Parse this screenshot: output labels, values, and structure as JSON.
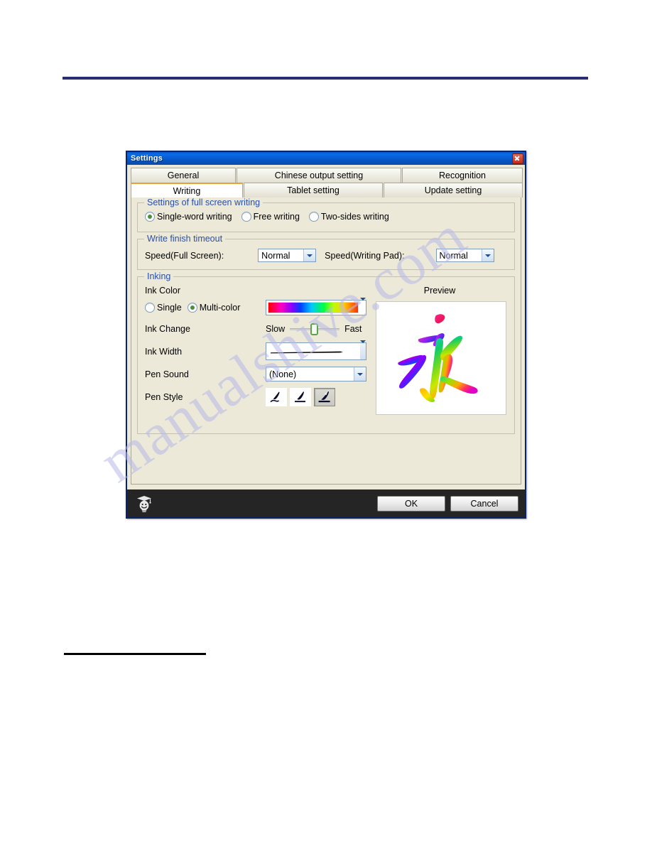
{
  "dialog": {
    "title": "Settings",
    "close_label": "Close"
  },
  "tabs": {
    "row1": [
      {
        "label": "General",
        "active": false
      },
      {
        "label": "Chinese output setting",
        "active": false
      },
      {
        "label": "Recognition",
        "active": false
      }
    ],
    "row2": [
      {
        "label": "Writing",
        "active": true
      },
      {
        "label": "Tablet setting",
        "active": false
      },
      {
        "label": "Update setting",
        "active": false
      }
    ]
  },
  "full_screen_writing": {
    "legend": "Settings of full screen writing",
    "options": [
      {
        "label": "Single-word writing",
        "selected": true
      },
      {
        "label": "Free writing",
        "selected": false
      },
      {
        "label": "Two-sides writing",
        "selected": false
      }
    ]
  },
  "write_finish_timeout": {
    "legend": "Write finish timeout",
    "full_screen_label": "Speed(Full Screen):",
    "full_screen_value": "Normal",
    "writing_pad_label": "Speed(Writing Pad):",
    "writing_pad_value": "Normal"
  },
  "inking": {
    "legend": "Inking",
    "ink_color_label": "Ink Color",
    "preview_label": "Preview",
    "color_modes": [
      {
        "label": "Single",
        "selected": false
      },
      {
        "label": "Multi-color",
        "selected": true
      }
    ],
    "ink_change_label": "Ink Change",
    "ink_change_min": "Slow",
    "ink_change_max": "Fast",
    "ink_width_label": "Ink Width",
    "pen_sound_label": "Pen Sound",
    "pen_sound_value": "(None)",
    "pen_style_label": "Pen Style",
    "pen_styles": [
      {
        "name": "pen-style-brush-thin",
        "selected": false
      },
      {
        "name": "pen-style-brush-medium",
        "selected": false
      },
      {
        "name": "pen-style-brush-bold",
        "selected": true
      }
    ],
    "preview_character": "永"
  },
  "footer": {
    "ok_label": "OK",
    "cancel_label": "Cancel",
    "mascot_name": "graduate-bulb-mascot"
  },
  "watermark": {
    "text": "manualshive.com"
  },
  "colors": {
    "titlebar_blue": "#0a6ae8",
    "legend_blue": "#2a4fa8",
    "dialog_face": "#ece9d8",
    "active_tab_accent": "#e8a13a",
    "footer_dark": "#252526",
    "radio_dot_green": "#4a8f3c",
    "slider_green": "#5ca34b",
    "page_rule_navy": "#2b2d72"
  }
}
